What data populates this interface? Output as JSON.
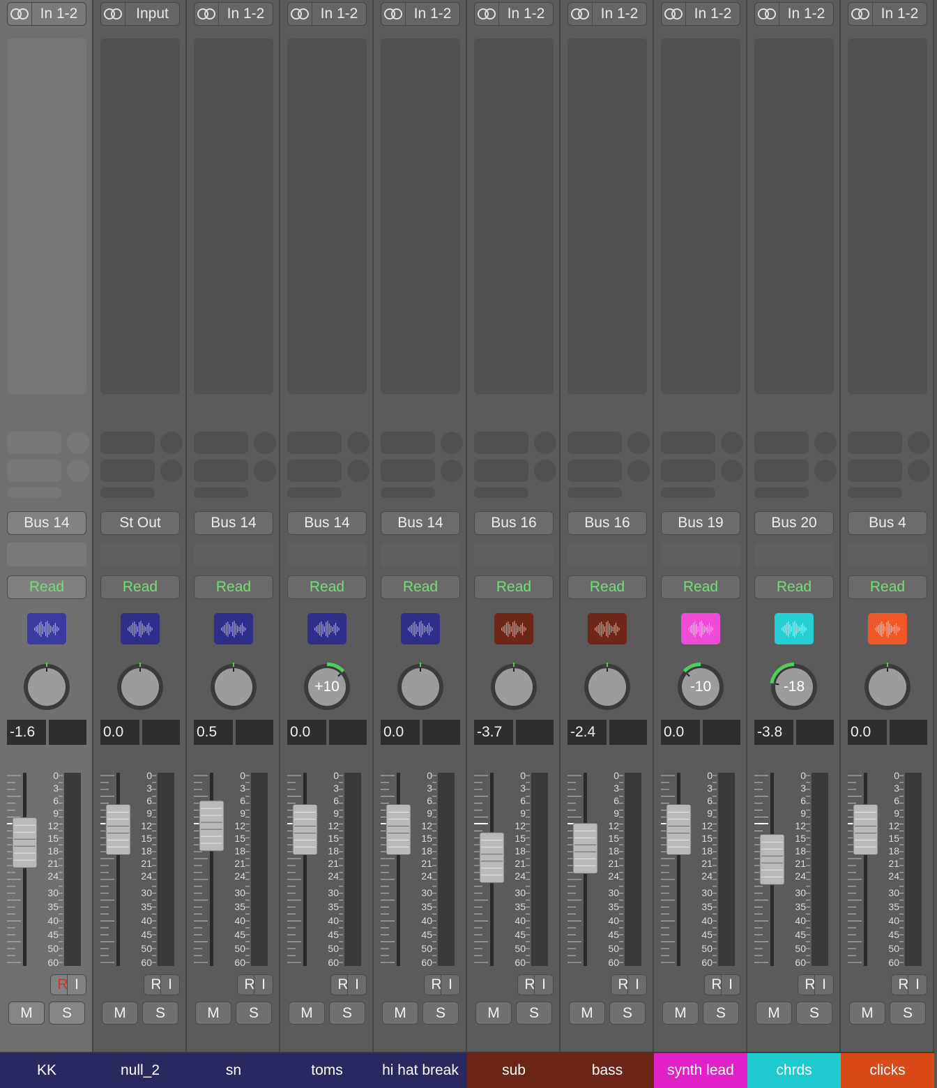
{
  "strips": [
    {
      "name": "KK",
      "input": "In 1-2",
      "output": "Bus 14",
      "automation": "Read",
      "gain": "-1.6",
      "pan": null,
      "pan_pos": 0.0,
      "fader_level": 0.21,
      "name_color": "#2a2860",
      "icon_color": "#3a3aa0",
      "rec_active": true,
      "selected": true,
      "icon": "audio-waveform-icon"
    },
    {
      "name": "null_2",
      "input": "Input",
      "output": "St Out",
      "automation": "Read",
      "gain": "0.0",
      "pan": null,
      "pan_pos": 0.0,
      "fader_level": 0.14,
      "name_color": "#2a2860",
      "icon_color": "#2f2e8a",
      "rec_active": false,
      "selected": false,
      "icon": "audio-waveform-icon"
    },
    {
      "name": "sn",
      "input": "In 1-2",
      "output": "Bus 14",
      "automation": "Read",
      "gain": "0.5",
      "pan": null,
      "pan_pos": 0.0,
      "fader_level": 0.12,
      "name_color": "#2a2860",
      "icon_color": "#2f2e8a",
      "rec_active": false,
      "selected": false,
      "icon": "audio-waveform-icon"
    },
    {
      "name": "toms",
      "input": "In 1-2",
      "output": "Bus 14",
      "automation": "Read",
      "gain": "0.0",
      "pan": "+10",
      "pan_pos": 0.16,
      "fader_level": 0.14,
      "name_color": "#2a2860",
      "icon_color": "#2f2e8a",
      "rec_active": false,
      "selected": false,
      "icon": "audio-waveform-icon"
    },
    {
      "name": "hi hat break",
      "input": "In 1-2",
      "output": "Bus 14",
      "automation": "Read",
      "gain": "0.0",
      "pan": null,
      "pan_pos": 0.0,
      "fader_level": 0.14,
      "name_color": "#2a2860",
      "icon_color": "#2f2e8a",
      "rec_active": false,
      "selected": false,
      "icon": "audio-waveform-icon"
    },
    {
      "name": "sub",
      "input": "In 1-2",
      "output": "Bus 16",
      "automation": "Read",
      "gain": "-3.7",
      "pan": null,
      "pan_pos": 0.0,
      "fader_level": 0.29,
      "name_color": "#6b2416",
      "icon_color": "#6e2618",
      "rec_active": false,
      "selected": false,
      "icon": "audio-waveform-icon"
    },
    {
      "name": "bass",
      "input": "In 1-2",
      "output": "Bus 16",
      "automation": "Read",
      "gain": "-2.4",
      "pan": null,
      "pan_pos": 0.0,
      "fader_level": 0.24,
      "name_color": "#6b2416",
      "icon_color": "#6e2618",
      "rec_active": false,
      "selected": false,
      "icon": "audio-waveform-icon"
    },
    {
      "name": "synth lead",
      "input": "In 1-2",
      "output": "Bus 19",
      "automation": "Read",
      "gain": "0.0",
      "pan": "-10",
      "pan_pos": -0.16,
      "fader_level": 0.14,
      "name_color": "#e021c8",
      "icon_color": "#f04ad8",
      "rec_active": false,
      "selected": false,
      "icon": "audio-waveform-icon"
    },
    {
      "name": "chrds",
      "input": "In 1-2",
      "output": "Bus 20",
      "automation": "Read",
      "gain": "-3.8",
      "pan": "-18",
      "pan_pos": -0.28,
      "fader_level": 0.3,
      "name_color": "#1ec9cf",
      "icon_color": "#25cfd4",
      "rec_active": false,
      "selected": false,
      "icon": "audio-waveform-icon"
    },
    {
      "name": "clicks",
      "input": "In 1-2",
      "output": "Bus 4",
      "automation": "Read",
      "gain": "0.0",
      "pan": null,
      "pan_pos": 0.0,
      "fader_level": 0.14,
      "name_color": "#d94a18",
      "icon_color": "#f0582a",
      "rec_active": false,
      "selected": false,
      "icon": "audio-waveform-icon"
    }
  ],
  "fader_scale": [
    "0",
    "3",
    "6",
    "9",
    "12",
    "15",
    "18",
    "21",
    "24",
    "30",
    "35",
    "40",
    "45",
    "50",
    "60"
  ],
  "labels": {
    "rec": "R",
    "input_monitor": "I",
    "mute": "M",
    "solo": "S"
  },
  "colors": {
    "automation_read": "#72df72",
    "pan_ring": "#4fce5c",
    "rec_active": "#d83030"
  }
}
